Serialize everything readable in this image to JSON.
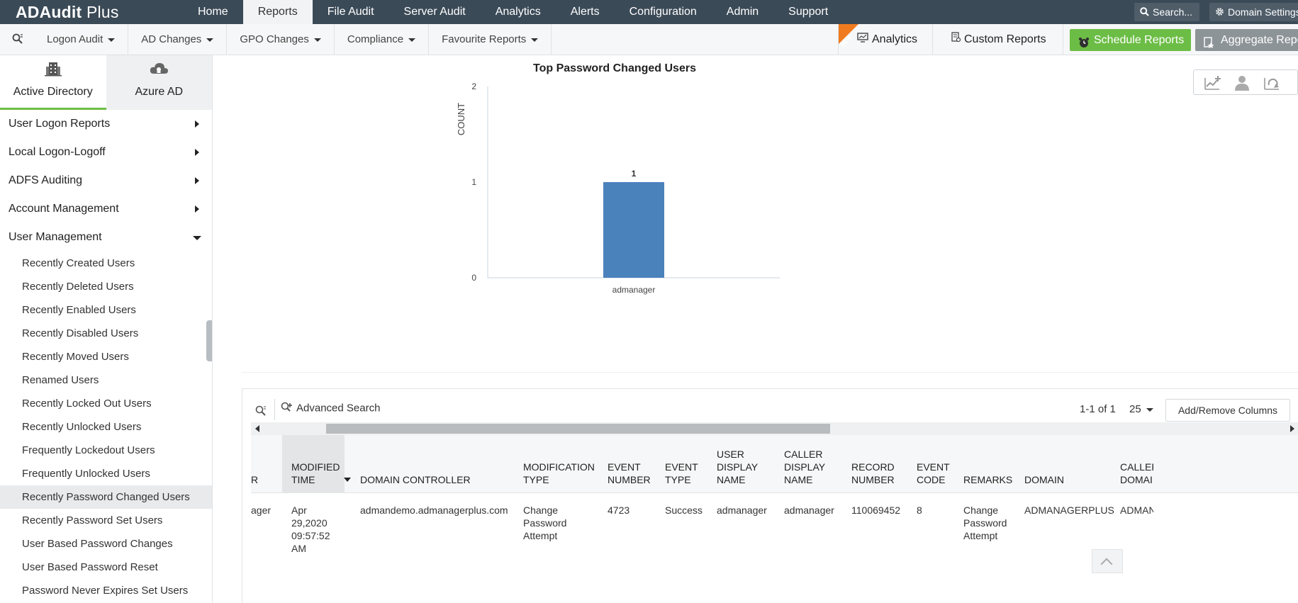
{
  "app": {
    "logo_bold": "ADAudit",
    "logo_thin": " Plus"
  },
  "topnav": {
    "items": [
      "Home",
      "Reports",
      "File Audit",
      "Server Audit",
      "Analytics",
      "Alerts",
      "Configuration",
      "Admin",
      "Support"
    ],
    "active": "Reports",
    "search_label": "Search...",
    "domain_label": "Domain Settings"
  },
  "subbar": {
    "menus": [
      "Logon Audit",
      "AD Changes",
      "GPO Changes",
      "Compliance",
      "Favourite Reports"
    ],
    "new_badge": "NEW",
    "analytics_label": "Analytics",
    "custom_reports_label": "Custom Reports",
    "schedule_reports_label": "Schedule Reports",
    "aggregate_reports_label": "Aggregate Reports"
  },
  "sidebar": {
    "tabs": [
      "Active Directory",
      "Azure AD"
    ],
    "sections": [
      "User Logon Reports",
      "Local Logon-Logoff",
      "ADFS Auditing",
      "Account Management",
      "User Management"
    ],
    "items": [
      "Recently Created Users",
      "Recently Deleted Users",
      "Recently Enabled Users",
      "Recently Disabled Users",
      "Recently Moved Users",
      "Renamed Users",
      "Recently Locked Out Users",
      "Recently Unlocked Users",
      "Frequently Lockedout Users",
      "Frequently Unlocked Users",
      "Recently Password Changed Users",
      "Recently Password Set Users",
      "User Based Password Changes",
      "User Based Password Reset",
      "Password Never Expires Set Users"
    ],
    "active_item": "Recently Password Changed Users"
  },
  "chart_data": {
    "type": "bar",
    "title": "Top Password Changed Users",
    "ylabel": "COUNT",
    "xlabel": "",
    "categories": [
      "admanager"
    ],
    "values": [
      1
    ],
    "ylim": [
      0,
      2
    ],
    "yticks": [
      0,
      1,
      2
    ],
    "data_labels": [
      "1"
    ],
    "bar_color": "#4a82bc",
    "grid": false
  },
  "table": {
    "advanced_search_label": "Advanced Search",
    "pagination": "1-1 of 1",
    "per_page": "25",
    "add_remove_label": "Add/Remove Columns",
    "columns": [
      "R",
      "MODIFIED TIME",
      "DOMAIN CONTROLLER",
      "MODIFICATION TYPE",
      "EVENT NUMBER",
      "EVENT TYPE",
      "USER DISPLAY NAME",
      "CALLER DISPLAY NAME",
      "RECORD NUMBER",
      "EVENT CODE",
      "REMARKS",
      "DOMAIN",
      "CALLER DOMAIN"
    ],
    "rows": [
      [
        "ager",
        "Apr 29,2020 09:57:52 AM",
        "admandemo.admanagerplus.com",
        "Change Password Attempt",
        "4723",
        "Success",
        "admanager",
        "admanager",
        "110069452",
        "8",
        "Change Password Attempt",
        "ADMANAGERPLUS",
        "ADMANAGERPLUS"
      ]
    ]
  }
}
